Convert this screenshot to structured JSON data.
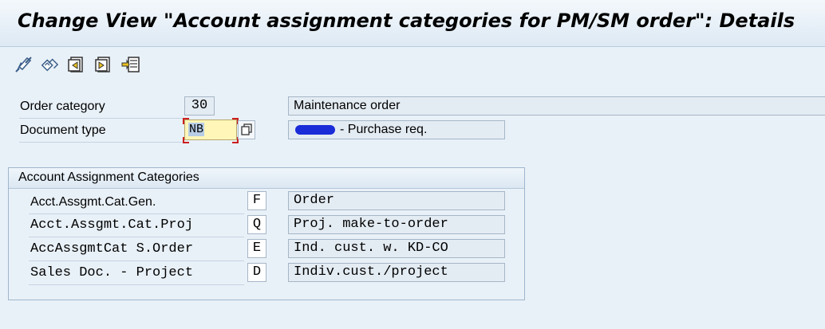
{
  "window": {
    "title": "Change View \"Account assignment categories for PM/SM order\": Details"
  },
  "toolbar": {
    "buttons": [
      {
        "icon": "display-change-icon"
      },
      {
        "icon": "undo-changes-icon"
      },
      {
        "icon": "previous-entry-icon"
      },
      {
        "icon": "next-entry-icon"
      },
      {
        "icon": "variable-list-icon"
      }
    ]
  },
  "header": {
    "order_category": {
      "label": "Order category",
      "value": "30",
      "description": "Maintenance order"
    },
    "document_type": {
      "label": "Document type",
      "value": "NB",
      "description": "- Purchase req."
    }
  },
  "account_assignment": {
    "title": "Account Assignment Categories",
    "rows": [
      {
        "label": "Acct.Assgmt.Cat.Gen.",
        "code": "F",
        "description": "Order"
      },
      {
        "label": "Acct.Assgmt.Cat.Proj",
        "code": "Q",
        "description": "Proj. make-to-order"
      },
      {
        "label": "AccAssgmtCat S.Order",
        "code": "E",
        "description": "Ind. cust. w. KD-CO"
      },
      {
        "label": "Sales Doc. - Project",
        "code": "D",
        "description": "Indiv.cust./project"
      }
    ]
  },
  "colors": {
    "background": "#e9f1f8",
    "input_highlight": "#fff6b8",
    "focus_marker": "#cc1f1f",
    "redaction": "#1a2bd8"
  }
}
